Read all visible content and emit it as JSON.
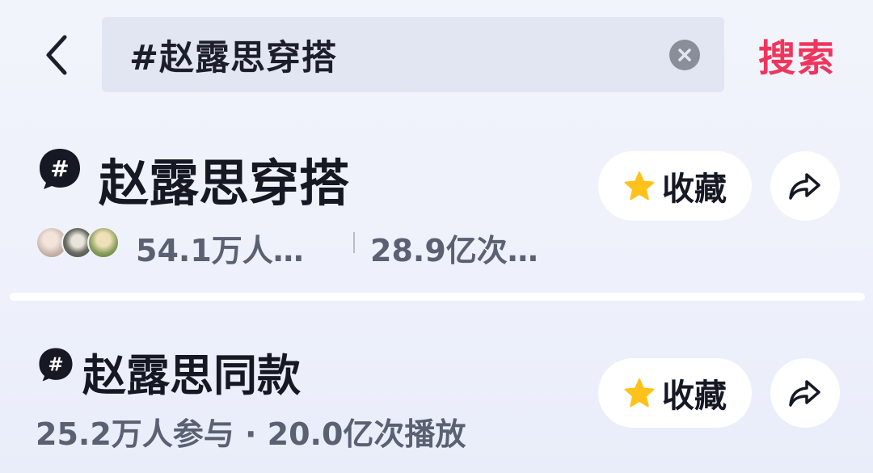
{
  "search": {
    "query": "#赵露思穿搭",
    "submit_label": "搜索"
  },
  "topics": [
    {
      "title": "赵露思穿搭",
      "participants": "54.1万人…",
      "views": "28.9亿次…",
      "favorite_label": "收藏"
    },
    {
      "title": "赵露思同款",
      "stats": "25.2万人参与 · 20.0亿次播放",
      "favorite_label": "收藏"
    }
  ],
  "colors": {
    "accent": "#f0355d",
    "star": "#ffc21a",
    "text_primary": "#161823",
    "text_secondary": "#5b6072"
  }
}
